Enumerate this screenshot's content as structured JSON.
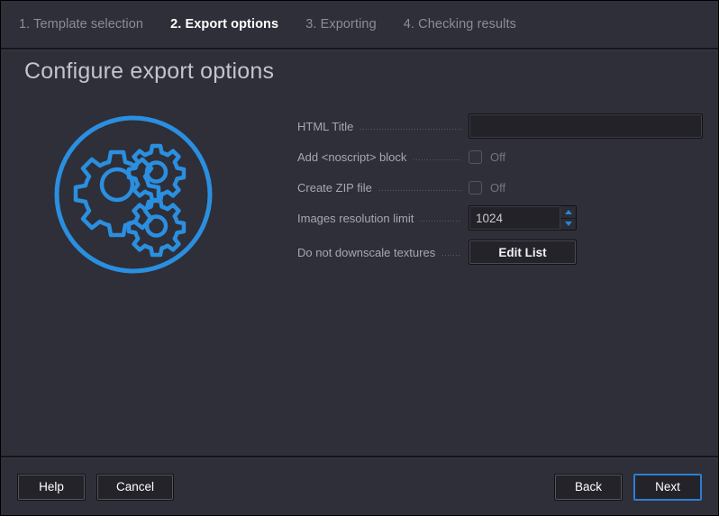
{
  "window": {
    "title": "Configure export options"
  },
  "steps": [
    {
      "label": "1. Template selection",
      "active": false
    },
    {
      "label": "2. Export options",
      "active": true
    },
    {
      "label": "3. Exporting",
      "active": false
    },
    {
      "label": "4. Checking results",
      "active": false
    }
  ],
  "illustration": {
    "name": "gears-circle-icon",
    "accent_color": "#2b8fe0",
    "description": "Three gears inside a circle outline"
  },
  "form": {
    "rows": [
      {
        "label": "HTML Title",
        "control": "text-input",
        "value": "",
        "placeholder": ""
      },
      {
        "label": "Add <noscript> block",
        "control": "checkbox",
        "checked": false,
        "state_text": "Off"
      },
      {
        "label": "Create ZIP file",
        "control": "checkbox",
        "checked": false,
        "state_text": "Off"
      },
      {
        "label": "Images resolution limit",
        "control": "spinbox",
        "value": "1024"
      },
      {
        "label": "Do not downscale textures",
        "control": "button",
        "button_label": "Edit List"
      }
    ]
  },
  "footer": {
    "help_label": "Help",
    "cancel_label": "Cancel",
    "back_label": "Back",
    "next_label": "Next"
  },
  "colors": {
    "background": "#2e2f39",
    "accent": "#2b8fe0",
    "text_primary": "#ffffff",
    "text_muted": "#8b8c96",
    "title": "#c3c4cc"
  }
}
